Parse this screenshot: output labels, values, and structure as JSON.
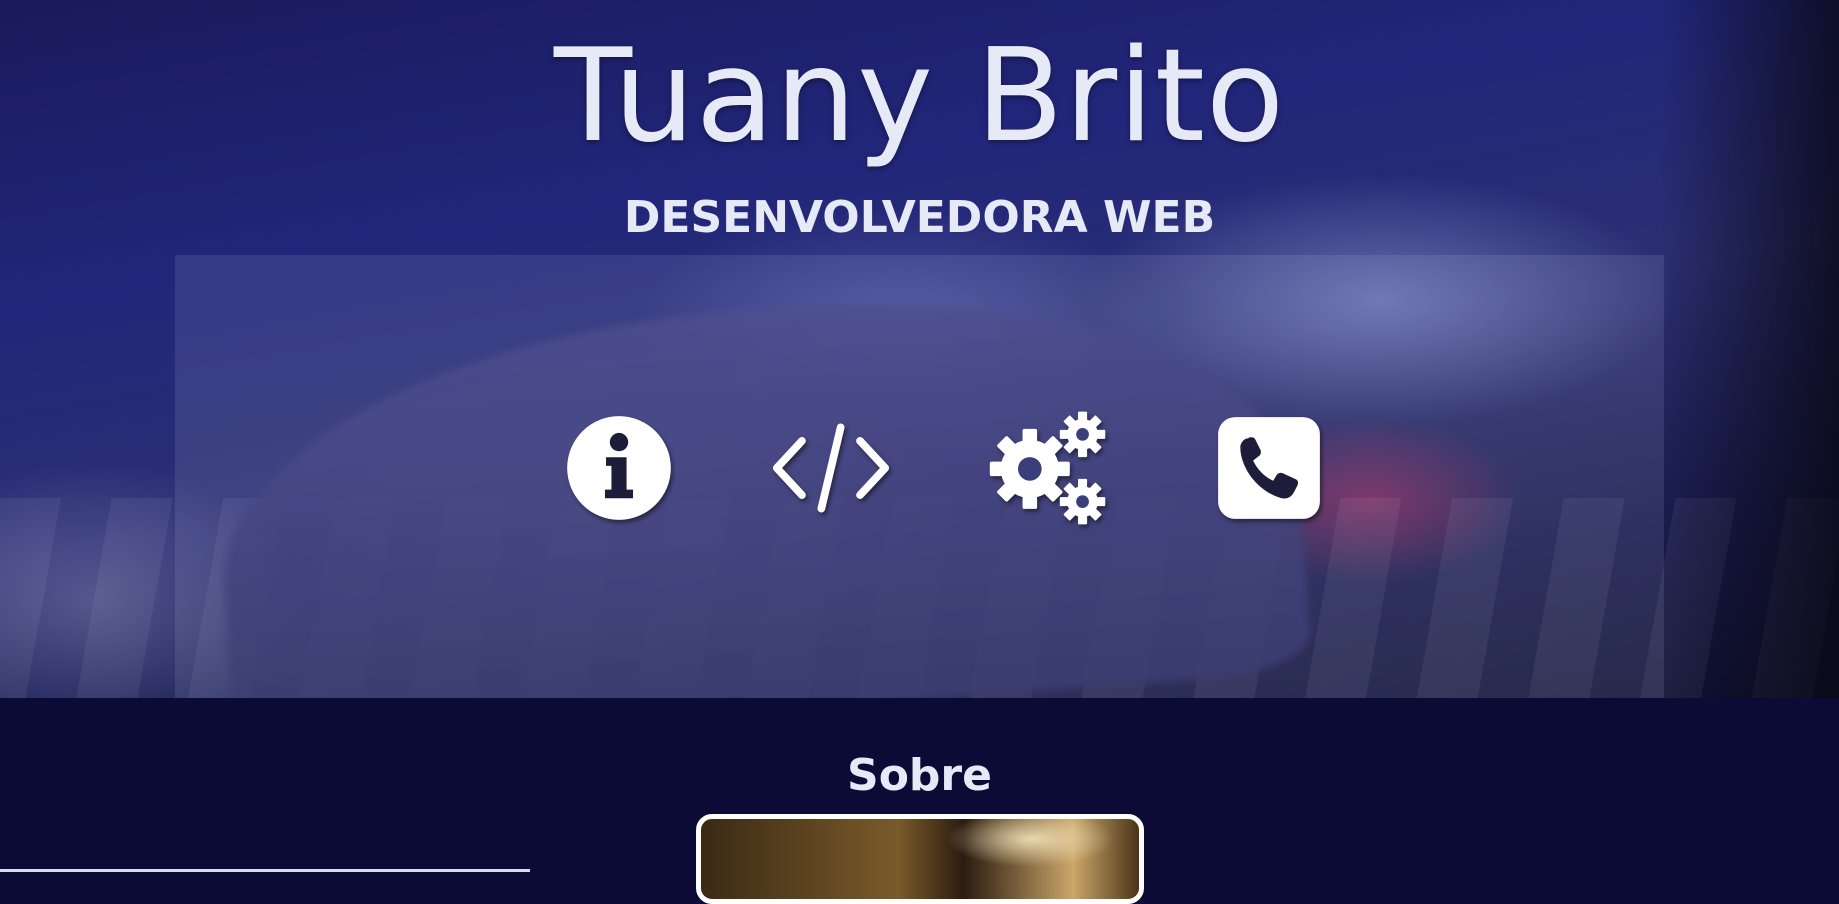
{
  "header": {
    "title": "Tuany Brito",
    "subtitle": "DESENVOLVEDORA WEB"
  },
  "nav_icons": [
    {
      "icon": "info-icon"
    },
    {
      "icon": "code-icon"
    },
    {
      "icon": "gears-icon"
    },
    {
      "icon": "phone-icon"
    }
  ],
  "about": {
    "title": "Sobre"
  },
  "colors": {
    "background": "#0b0b35",
    "text": "#e6eaf7",
    "icon": "#ffffff"
  }
}
